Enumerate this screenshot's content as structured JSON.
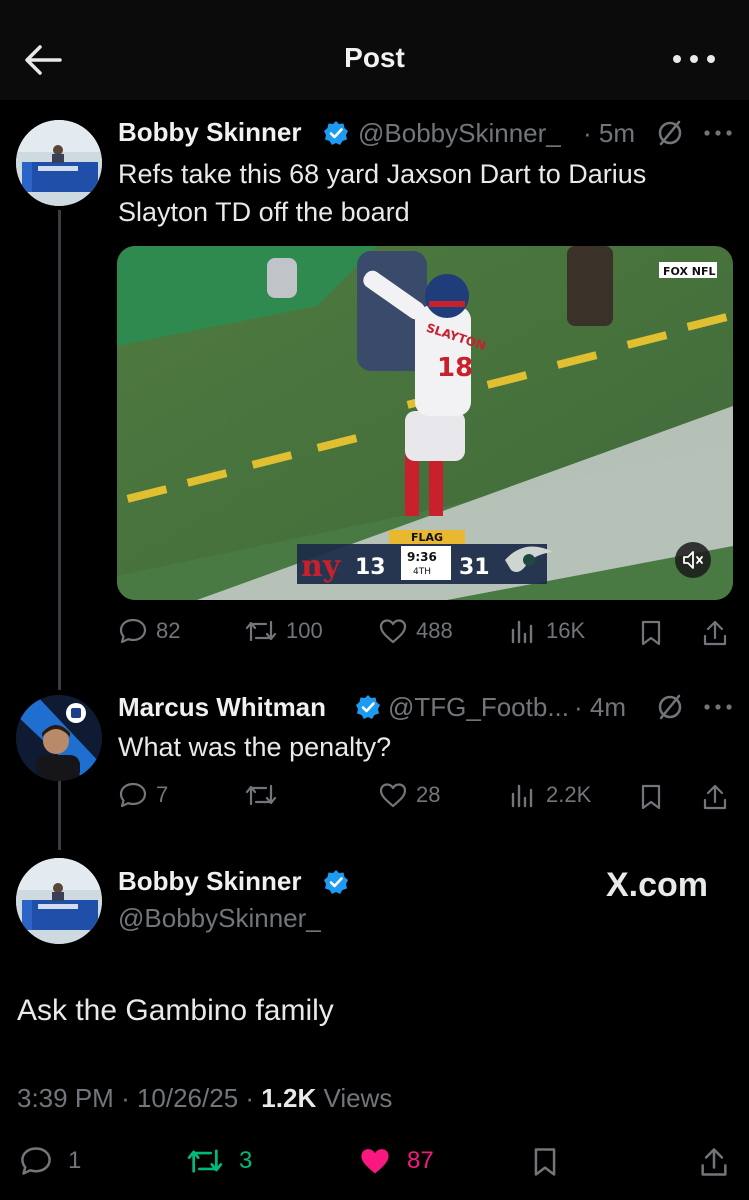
{
  "header": {
    "title": "Post",
    "back_icon": "arrow-left-icon",
    "more_icon": "more-icon"
  },
  "post1": {
    "name": "Bobby Skinner",
    "handle": "@BobbySkinner_",
    "time": "· 5m",
    "text": "Refs take this 68 yard Jaxson Dart to Darius Slayton TD off the board",
    "video": {
      "network": "FOX NFL",
      "flag": "FLAG",
      "home_score": "13",
      "away_score": "31",
      "clock": "9:36",
      "quarter": "4TH",
      "player_name": "SLAYTON",
      "jersey": "18"
    },
    "stats": {
      "replies": "82",
      "reposts": "100",
      "likes": "488",
      "views": "16K"
    }
  },
  "post2": {
    "name": "Marcus Whitman",
    "handle": "@TFG_Footb...",
    "time": "· 4m",
    "text": "What was the penalty?",
    "stats": {
      "replies": "7",
      "reposts": "",
      "likes": "28",
      "views": "2.2K"
    }
  },
  "main": {
    "name": "Bobby Skinner",
    "handle": "@BobbySkinner_",
    "watermark": "X.com",
    "text": "Ask the Gambino family",
    "time": "3:39 PM",
    "date": "10/26/25",
    "views_count": "1.2K",
    "views_label": "Views",
    "stats": {
      "replies": "1",
      "reposts": "3",
      "likes": "87"
    }
  },
  "colors": {
    "accent_blue": "#1d9bf0",
    "repost_green": "#00ba7c",
    "like_pink": "#f91880",
    "muted": "#71767b"
  }
}
